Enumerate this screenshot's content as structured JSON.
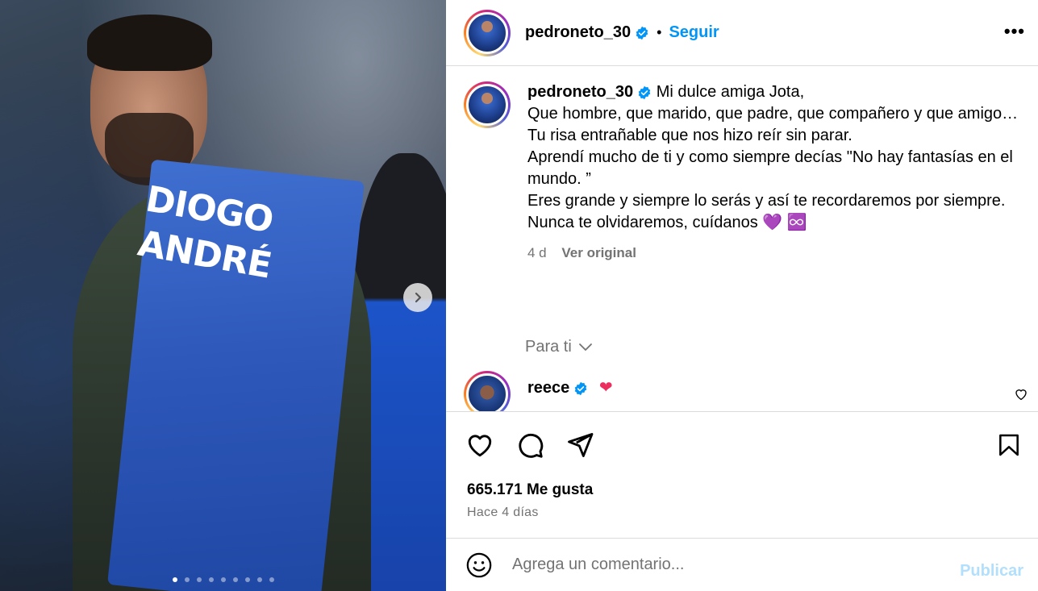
{
  "post": {
    "username": "pedroneto_30",
    "follow_label": "Seguir",
    "separator": "•",
    "more_label": "•••",
    "media": {
      "shirt_text_line1": "DIOGO",
      "shirt_text_line2": "ANDRÉ",
      "slide_count": 9,
      "active_slide": 1
    }
  },
  "caption": {
    "username": "pedroneto_30",
    "lines": [
      "Mi dulce amiga Jota,",
      "Que hombre, que marido, que padre, que compañero y que amigo…",
      "Tu risa entrañable que nos hizo reír sin parar.",
      "Aprendí mucho de ti y como siempre decías \"No hay fantasías en el mundo. ”",
      "Eres grande y siempre lo serás y así te recordaremos por siempre.",
      "Nunca te olvidaremos, cuídanos 💜 ♾️"
    ],
    "time": "4 d",
    "see_original": "Ver original"
  },
  "for_you": {
    "label": "Para ti"
  },
  "reply": {
    "username": "reece",
    "emoji": "❤"
  },
  "stats": {
    "likes": "665.171 Me gusta",
    "time": "Hace 4 días"
  },
  "comment": {
    "placeholder": "Agrega un comentario...",
    "publish_label": "Publicar"
  },
  "colors": {
    "accent": "#0095f6",
    "muted": "#737373",
    "publish_disabled": "#b2dffc"
  }
}
